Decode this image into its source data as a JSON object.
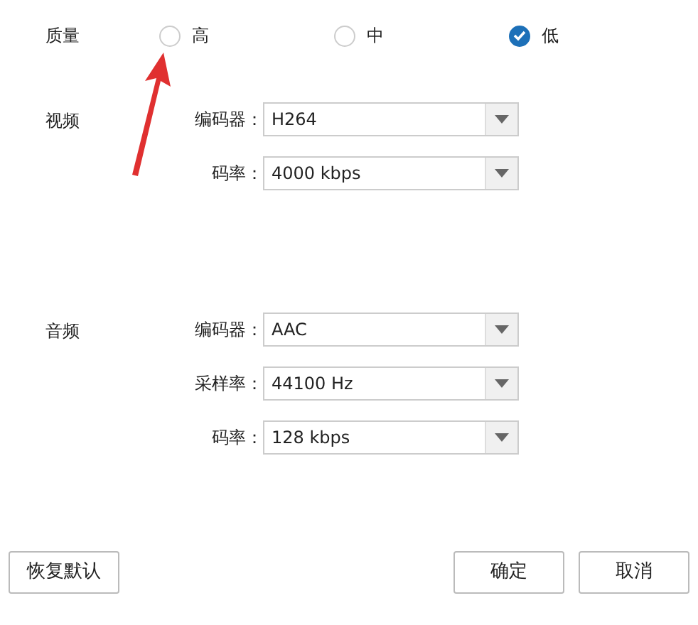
{
  "quality": {
    "label": "质量",
    "options": [
      {
        "label": "高",
        "selected": false
      },
      {
        "label": "中",
        "selected": false
      },
      {
        "label": "低",
        "selected": true
      }
    ]
  },
  "sections": [
    {
      "label": "视频",
      "fields": [
        {
          "label": "编码器：",
          "value": "H264"
        },
        {
          "label": "码率：",
          "value": "4000 kbps"
        }
      ]
    },
    {
      "label": "音频",
      "fields": [
        {
          "label": "编码器：",
          "value": "AAC"
        },
        {
          "label": "采样率：",
          "value": "44100 Hz"
        },
        {
          "label": "码率：",
          "value": "128 kbps"
        }
      ]
    }
  ],
  "buttons": [
    {
      "label": "恢复默认",
      "kind": "left"
    },
    {
      "label": "确定",
      "kind": "right"
    },
    {
      "label": "取消",
      "kind": "right"
    }
  ],
  "annotation": {
    "kind": "arrow"
  }
}
